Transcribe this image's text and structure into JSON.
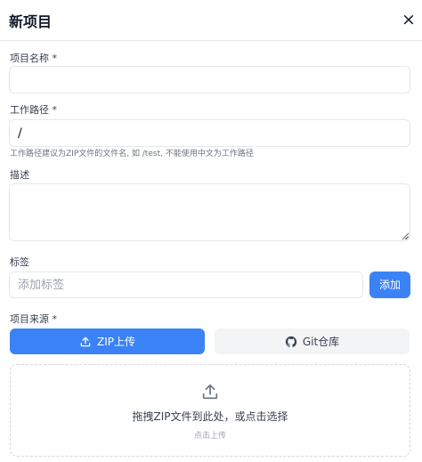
{
  "dialog": {
    "title": "新项目",
    "close_glyph": "×"
  },
  "form": {
    "name": {
      "label": "项目名称 *",
      "value": "",
      "placeholder": ""
    },
    "path": {
      "label": "工作路径 *",
      "value": "/",
      "hint": "工作路径建议为ZIP文件的文件名, 如 /test, 不能使用中文为工作路径"
    },
    "description": {
      "label": "描述",
      "value": ""
    },
    "tags": {
      "label": "标签",
      "placeholder": "添加标签",
      "add_label": "添加"
    },
    "source": {
      "label": "项目来源 *",
      "options": [
        {
          "label": "ZIP上传",
          "icon": "upload-icon",
          "selected": true
        },
        {
          "label": "Git仓库",
          "icon": "github-icon",
          "selected": false
        }
      ],
      "dropzone": {
        "icon": "upload-icon",
        "text": "拖拽ZIP文件到此处，或点击选择",
        "subtext": "点击上传"
      }
    }
  },
  "colors": {
    "accent": "#3b82f6",
    "secondary_bg": "#f3f4f6",
    "border": "#e5e7eb"
  }
}
